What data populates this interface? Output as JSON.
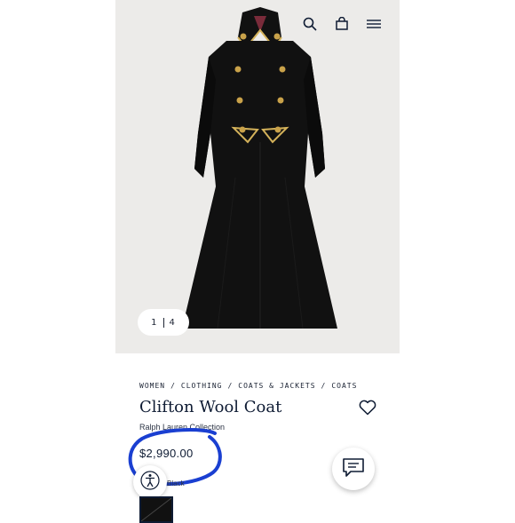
{
  "gallery": {
    "current_page": "1",
    "total_pages": "4"
  },
  "header_icons": [
    "search-icon",
    "shopping-bag-icon",
    "menu-icon"
  ],
  "breadcrumb": [
    "WOMEN",
    "/",
    "CLOTHING",
    "/",
    "COATS & JACKETS",
    "/",
    "COATS"
  ],
  "product": {
    "title": "Clifton Wool Coat",
    "brand": "Ralph Lauren Collection",
    "price": "$2,990.00",
    "color_label": "Black"
  },
  "colors": {
    "accent": "#0e1b33",
    "image_bg": "#ecebe9",
    "annotation_circle": "#1a3fd1",
    "coat": "#111111",
    "trim": "#d4b25a"
  }
}
